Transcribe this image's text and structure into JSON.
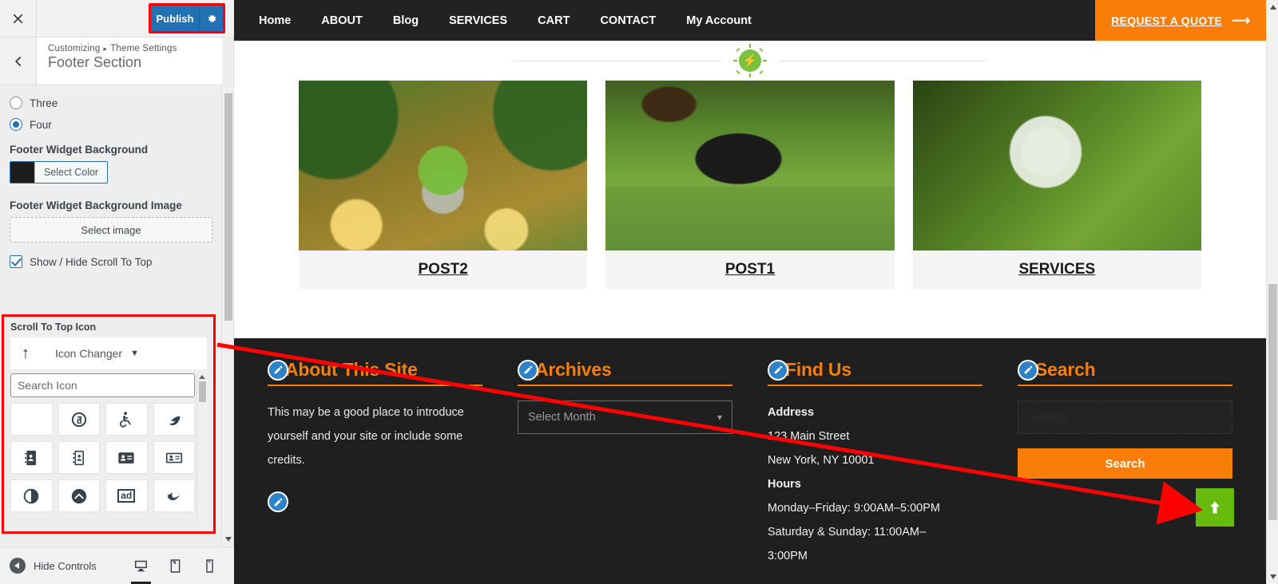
{
  "customizer": {
    "close_icon": "close-icon",
    "publish_label": "Publish",
    "gear_icon": "gear-icon",
    "back_icon": "chevron-left-icon",
    "breadcrumb_root": "Customizing",
    "breadcrumb_parent": "Theme Settings",
    "breadcrumb_separator": "▸",
    "section_title": "Footer Section",
    "column_options": [
      {
        "label": "Three",
        "checked": false
      },
      {
        "label": "Four",
        "checked": true
      }
    ],
    "footer_widget_background": {
      "label": "Footer Widget Background",
      "button_label": "Select Color",
      "color": "#1d1d1d"
    },
    "footer_widget_bg_image": {
      "label": "Footer Widget Background Image",
      "button_label": "Select image"
    },
    "scroll_to_top_toggle": {
      "label": "Show / Hide Scroll To Top",
      "checked": true
    },
    "scroll_to_top_icon": {
      "group_label": "Scroll To Top Icon",
      "current_icon": "arrow-up-icon",
      "changer_label": "Icon Changer",
      "caret_icon": "chevron-down-icon",
      "search_placeholder": "Search Icon",
      "search_value": "",
      "icons": [
        "blank-icon",
        "fingerprint-500px-icon",
        "wheelchair-icon",
        "accessible-icon",
        "address-book-solid-icon",
        "address-book-outline-icon",
        "address-card-solid-icon",
        "address-card-outline-icon",
        "adjust-icon",
        "angle-up-circle-icon",
        "ad-icon",
        "swoosh-icon"
      ]
    },
    "bottom_bar": {
      "hide_controls_label": "Hide Controls",
      "hide_controls_icon": "arrow-left-circle-icon",
      "devices": [
        {
          "name": "desktop-preview-icon",
          "active": true
        },
        {
          "name": "tablet-preview-icon",
          "active": false
        },
        {
          "name": "mobile-preview-icon",
          "active": false
        }
      ]
    },
    "highlight_color": "#ff0000",
    "publish_color": "#2271b1"
  },
  "preview": {
    "nav": {
      "links": [
        "Home",
        "ABOUT",
        "Blog",
        "SERVICES",
        "CART",
        "CONTACT",
        "My Account"
      ],
      "cta_label": "REQUEST A QUOTE",
      "cta_arrow_icon": "arrow-right-icon",
      "cta_color": "#f97d09",
      "bar_color": "#222222"
    },
    "divider": {
      "badge_icon": "lightning-bolt-icon",
      "badge_color": "#7ac142"
    },
    "cards": [
      {
        "title": "POST2",
        "image": "tree-in-glass-globe-image"
      },
      {
        "title": "POST1",
        "image": "laptop-on-grass-image"
      },
      {
        "title": "SERVICES",
        "image": "lightbulb-on-grass-image"
      }
    ],
    "footer": {
      "background": "#1f1f1f",
      "accent": "#f97d09",
      "widgets": [
        {
          "title": "About This Site",
          "edit_icon": "edit-pencil-icon",
          "body": "This may be a good place to introduce yourself and your site or include some credits."
        },
        {
          "title": "Archives",
          "edit_icon": "edit-pencil-icon",
          "select_value": "Select Month",
          "select_caret": "chevron-down-icon"
        },
        {
          "title": "Find Us",
          "edit_icon": "edit-pencil-icon",
          "lines": [
            {
              "text": "Address",
              "bold": true
            },
            {
              "text": "123 Main Street",
              "bold": false
            },
            {
              "text": "New York, NY 10001",
              "bold": false
            },
            {
              "text": "Hours",
              "bold": true
            },
            {
              "text": "Monday–Friday: 9:00AM–5:00PM",
              "bold": false
            },
            {
              "text": "Saturday & Sunday: 11:00AM–",
              "bold": false
            },
            {
              "text": "3:00PM",
              "bold": false
            }
          ]
        },
        {
          "title": "Search",
          "edit_icon": "edit-pencil-icon",
          "search_placeholder": "Search",
          "submit_label": "Search"
        }
      ],
      "extra_edit_icon": "edit-pencil-icon"
    },
    "scroll_to_top_button": {
      "icon": "arrow-up-icon",
      "color": "#66bb0b"
    }
  }
}
